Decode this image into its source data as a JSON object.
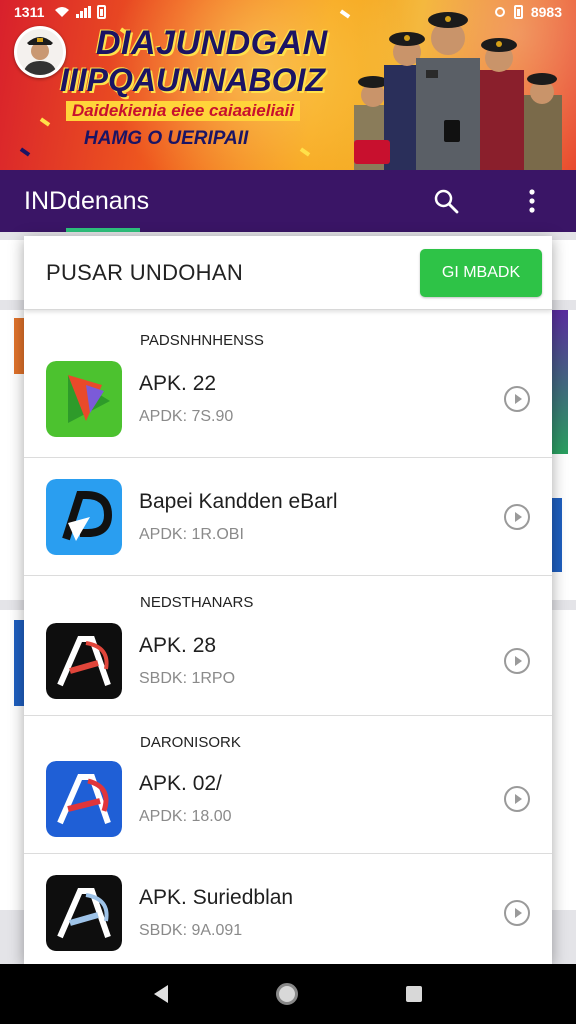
{
  "status_bar": {
    "time": "1311",
    "battery": "8983"
  },
  "banner": {
    "title_line1": "DIAJUNDGAN",
    "title_line2": "IIIPQAUNNABOIZ",
    "subtitle_line1": "Daidekienia eiee caiaaieliaii",
    "subtitle_line2": "HAMG O UERIPAII"
  },
  "appbar": {
    "title": "INDdenans"
  },
  "dialog": {
    "title": "PUSAR UNDOHAN",
    "primary_button": "GI MBADK",
    "items": [
      {
        "section": "PADSNHNHENSS",
        "name": "APK. 22",
        "version": "APDK: 7S.90",
        "icon": "green-arrow-app-icon"
      },
      {
        "section": "",
        "name": "Bapei Kandden eBarl",
        "version": "APDK: 1R.OBI",
        "icon": "blue-ap-app-icon"
      },
      {
        "section": "NEDSTHANARS",
        "name": "APK. 28",
        "version": "SBDK: 1RPO",
        "icon": "black-ad-app-icon"
      },
      {
        "section": "DARONISORK",
        "name": "APK. 02/",
        "version": "APDK: 18.00",
        "icon": "blue-red-ad-app-icon"
      },
      {
        "section": "",
        "name": "APK. Suriedblan",
        "version": "SBDK: 9A.091",
        "icon": "black-ad-app-icon"
      }
    ]
  },
  "colors": {
    "appbar": "#3a1566",
    "accent_green": "#2ec347",
    "tab_indicator": "#2ec27e"
  }
}
